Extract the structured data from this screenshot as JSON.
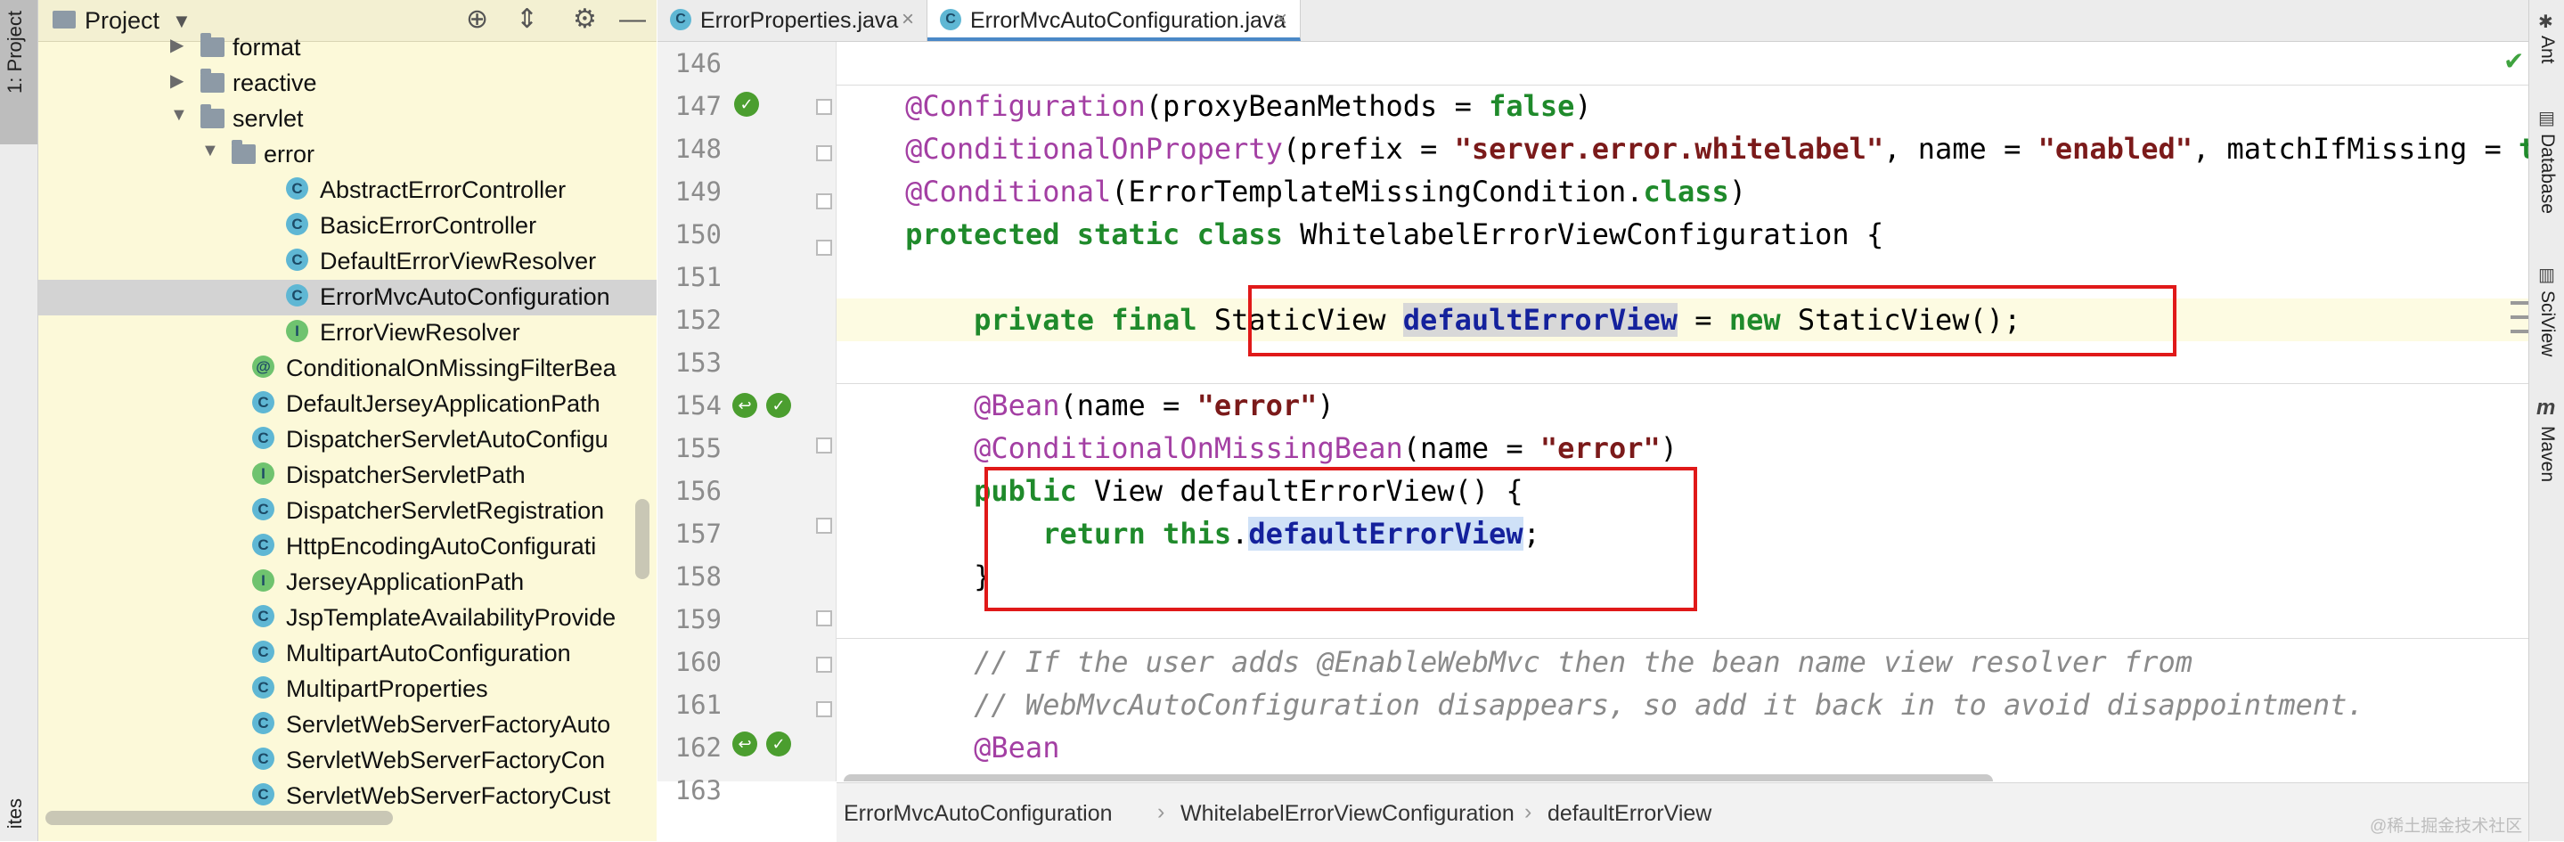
{
  "left_strip": {
    "project_tab": "1: Project",
    "bottom_tab": "ites"
  },
  "project_panel": {
    "title": "Project",
    "icons": [
      "folder-icon",
      "dropdown-arrow-icon",
      "crosshair-icon",
      "collapse-icon",
      "gear-icon",
      "minimize-icon"
    ],
    "tree": [
      {
        "label": "format",
        "type": "folder",
        "expanded": false
      },
      {
        "label": "reactive",
        "type": "folder",
        "expanded": false
      },
      {
        "label": "servlet",
        "type": "folder",
        "expanded": true
      },
      {
        "label": "error",
        "type": "folder",
        "expanded": true
      },
      {
        "label": "AbstractErrorController",
        "type": "class",
        "badge": "C"
      },
      {
        "label": "BasicErrorController",
        "type": "class",
        "badge": "C"
      },
      {
        "label": "DefaultErrorViewResolver",
        "type": "class",
        "badge": "C"
      },
      {
        "label": "ErrorMvcAutoConfiguration",
        "type": "class",
        "badge": "C",
        "selected": true
      },
      {
        "label": "ErrorViewResolver",
        "type": "interface",
        "badge": "I"
      },
      {
        "label": "ConditionalOnMissingFilterBea",
        "type": "annotation",
        "badge": "@"
      },
      {
        "label": "DefaultJerseyApplicationPath",
        "type": "class",
        "badge": "C"
      },
      {
        "label": "DispatcherServletAutoConfigu",
        "type": "class",
        "badge": "C"
      },
      {
        "label": "DispatcherServletPath",
        "type": "interface",
        "badge": "I"
      },
      {
        "label": "DispatcherServletRegistration",
        "type": "class",
        "badge": "C"
      },
      {
        "label": "HttpEncodingAutoConfigurati",
        "type": "class",
        "badge": "C"
      },
      {
        "label": "JerseyApplicationPath",
        "type": "interface",
        "badge": "I"
      },
      {
        "label": "JspTemplateAvailabilityProvide",
        "type": "class",
        "badge": "C"
      },
      {
        "label": "MultipartAutoConfiguration",
        "type": "class",
        "badge": "C"
      },
      {
        "label": "MultipartProperties",
        "type": "class",
        "badge": "C"
      },
      {
        "label": "ServletWebServerFactoryAuto",
        "type": "class",
        "badge": "C"
      },
      {
        "label": "ServletWebServerFactoryCon",
        "type": "class",
        "badge": "C"
      },
      {
        "label": "ServletWebServerFactoryCust",
        "type": "class",
        "badge": "C"
      }
    ]
  },
  "tabs": [
    {
      "label": "ErrorProperties.java",
      "active": false
    },
    {
      "label": "ErrorMvcAutoConfiguration.java",
      "active": true
    }
  ],
  "editor": {
    "lines": [
      {
        "n": "146"
      },
      {
        "n": "147"
      },
      {
        "n": "148"
      },
      {
        "n": "149"
      },
      {
        "n": "150"
      },
      {
        "n": "151"
      },
      {
        "n": "152"
      },
      {
        "n": "153"
      },
      {
        "n": "154"
      },
      {
        "n": "155"
      },
      {
        "n": "156"
      },
      {
        "n": "157"
      },
      {
        "n": "158"
      },
      {
        "n": "159"
      },
      {
        "n": "160"
      },
      {
        "n": "161"
      },
      {
        "n": "162"
      },
      {
        "n": "163"
      }
    ]
  },
  "breadcrumb": [
    "ErrorMvcAutoConfiguration",
    "WhitelabelErrorViewConfiguration",
    "defaultErrorView"
  ],
  "right_strip": [
    "Ant",
    "Database",
    "SciView",
    "Maven"
  ],
  "watermark": "@稀土掘金技术社区",
  "colors": {
    "accent": "#4a88c7",
    "highlight_box": "#e01919",
    "keyword": "#1f8a2b",
    "annotation": "#a33fa3"
  }
}
